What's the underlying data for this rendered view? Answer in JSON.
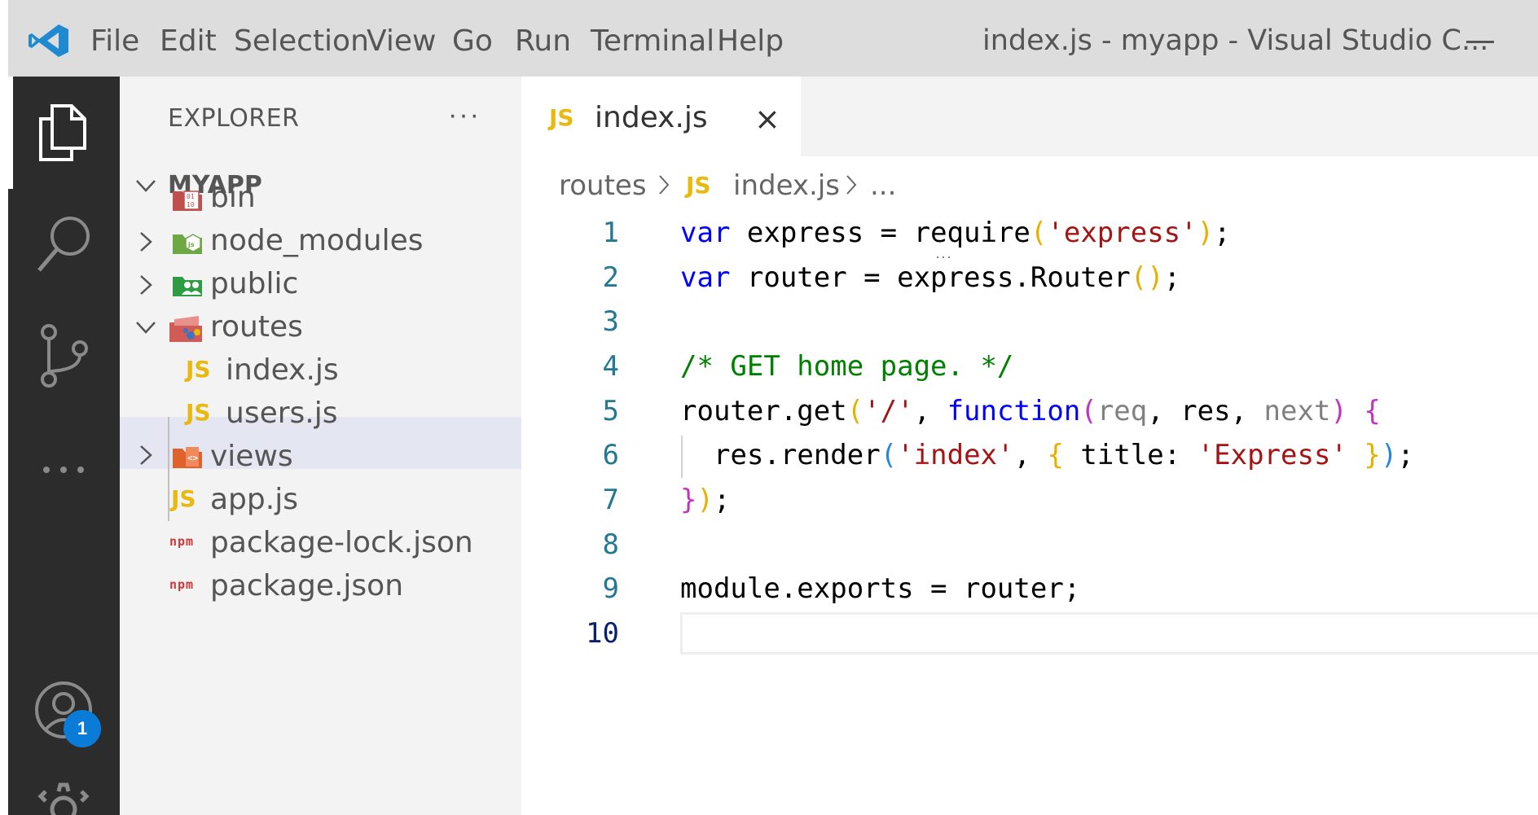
{
  "menu": {
    "items": [
      "File",
      "Edit",
      "Selection",
      "View",
      "Go",
      "Run",
      "Terminal",
      "Help"
    ],
    "window_title": "index.js - myapp - Visual Studio C..."
  },
  "activity_bar": {
    "icons": [
      "files-icon",
      "search-icon",
      "source-control-icon",
      "more-icon",
      "account-icon",
      "settings-gear-icon"
    ],
    "account_badge": "1"
  },
  "explorer": {
    "title": "EXPLORER",
    "more": "···",
    "root": "MYAPP",
    "items": [
      {
        "label": "bin",
        "type": "folder",
        "expanded": false
      },
      {
        "label": "node_modules",
        "type": "folder",
        "expanded": false
      },
      {
        "label": "public",
        "type": "folder",
        "expanded": false
      },
      {
        "label": "routes",
        "type": "folder",
        "expanded": true
      },
      {
        "label": "index.js",
        "type": "js",
        "selected": true
      },
      {
        "label": "users.js",
        "type": "js"
      },
      {
        "label": "views",
        "type": "folder",
        "expanded": false
      },
      {
        "label": "app.js",
        "type": "js"
      },
      {
        "label": "package-lock.json",
        "type": "npm"
      },
      {
        "label": "package.json",
        "type": "npm"
      }
    ]
  },
  "editor": {
    "tab": {
      "icon": "JS",
      "label": "index.js",
      "close": "×"
    },
    "breadcrumb": {
      "folder": "routes",
      "icon": "JS",
      "file": "index.js",
      "tail": "..."
    },
    "line_numbers": [
      "1",
      "2",
      "3",
      "4",
      "5",
      "6",
      "7",
      "8",
      "9",
      "10"
    ],
    "current_line": "10",
    "code": {
      "l1": {
        "kw": "var",
        "a": " express = ",
        "fn": "require",
        "o": "(",
        "str": "'express'",
        "cl": ")",
        "end": ";"
      },
      "l2": {
        "kw": "var",
        "a": " router = express.Router",
        "o": "(",
        "cl": ")",
        "end": ";"
      },
      "l4": {
        "comment": "/* GET home page. */"
      },
      "l5": {
        "a": "router.get",
        "o": "(",
        "str": "'/'",
        "b": ", ",
        "kw": "function",
        "o2": "(",
        "req": "req",
        "c": ", res, ",
        "next": "next",
        "cl2": ")",
        "d": " ",
        "brace": "{"
      },
      "l6": {
        "a": "res.render",
        "o": "(",
        "str": "'index'",
        "b": ", ",
        "ob": "{",
        "c": " title: ",
        "str2": "'Express'",
        "d": " ",
        "cb": "}",
        "cl": ")",
        "end": ";"
      },
      "l7": {
        "brace": "}",
        "cl": ")",
        "end": ";"
      },
      "l9": {
        "a": "module.exports = router;"
      }
    }
  },
  "colors": {
    "keyword": "#0000ff",
    "string": "#a31515",
    "comment": "#008000",
    "js_icon": "#e8b90e",
    "badge": "#0a7cd8"
  }
}
